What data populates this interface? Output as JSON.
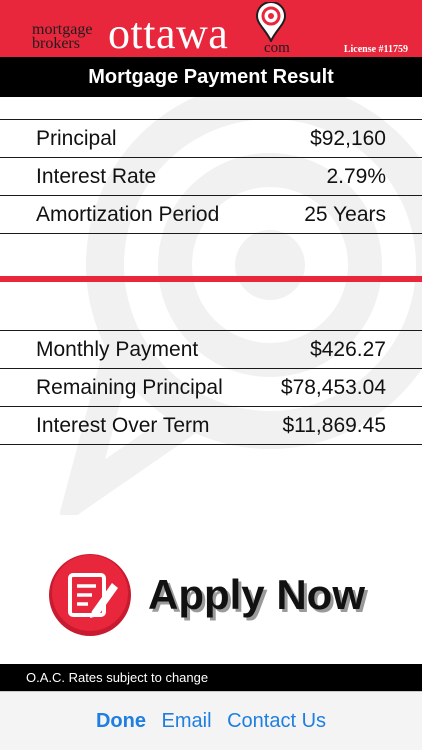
{
  "brand": {
    "logo_word_1": "mortgage",
    "logo_word_2": "brokers",
    "logo_word_3": "ottawa",
    "logo_suffix": "com",
    "license": "License #11759",
    "color": "#e8263c"
  },
  "title": "Mortgage Payment Result",
  "inputs": [
    {
      "label": "Principal",
      "value": "$92,160"
    },
    {
      "label": "Interest Rate",
      "value": "2.79%"
    },
    {
      "label": "Amortization Period",
      "value": "25 Years"
    }
  ],
  "results": [
    {
      "label": "Monthly Payment",
      "value": "$426.27"
    },
    {
      "label": "Remaining Principal",
      "value": "$78,453.04"
    },
    {
      "label": "Interest Over Term",
      "value": "$11,869.45"
    }
  ],
  "apply": {
    "label": "Apply Now",
    "icon": "edit-document-icon"
  },
  "notice": "O.A.C. Rates subject to change",
  "toolbar": {
    "done": "Done",
    "email": "Email",
    "contact": "Contact Us",
    "accent": "#1f7fe0"
  }
}
